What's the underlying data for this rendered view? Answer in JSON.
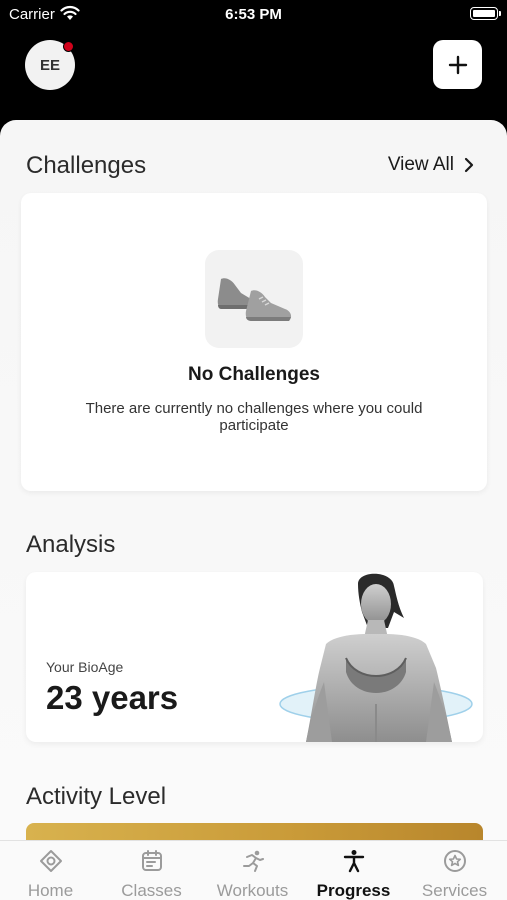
{
  "status_bar": {
    "carrier": "Carrier",
    "time": "6:53 PM"
  },
  "header": {
    "avatar_initials": "EE"
  },
  "challenges": {
    "title": "Challenges",
    "view_all": "View All",
    "empty_title": "No Challenges",
    "empty_text": "There are currently no challenges where you could participate"
  },
  "analysis": {
    "title": "Analysis",
    "bioage_label": "Your BioAge",
    "bioage_value": "23 years"
  },
  "activity": {
    "title": "Activity Level"
  },
  "tabs": [
    {
      "label": "Home",
      "icon": "home-icon"
    },
    {
      "label": "Classes",
      "icon": "calendar-icon"
    },
    {
      "label": "Workouts",
      "icon": "running-icon"
    },
    {
      "label": "Progress",
      "icon": "person-icon",
      "active": true
    },
    {
      "label": "Services",
      "icon": "star-icon"
    }
  ],
  "colors": {
    "accent_gold": "#c99a38",
    "notification": "#d0021b",
    "active_tab": "#111111",
    "inactive_tab": "#9b9b9b"
  }
}
